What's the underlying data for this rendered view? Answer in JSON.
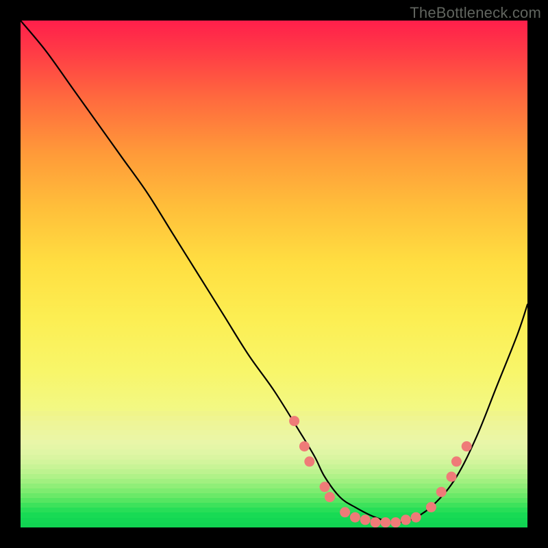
{
  "watermark": "TheBottleneck.com",
  "chart_data": {
    "type": "line",
    "title": "",
    "xlabel": "",
    "ylabel": "",
    "xlim": [
      0,
      100
    ],
    "ylim": [
      0,
      100
    ],
    "series": [
      {
        "name": "bottleneck-curve",
        "x": [
          0,
          5,
          10,
          15,
          20,
          25,
          30,
          35,
          40,
          45,
          50,
          55,
          58,
          60,
          63,
          66,
          70,
          74,
          78,
          82,
          86,
          90,
          94,
          98,
          100
        ],
        "y": [
          100,
          94,
          87,
          80,
          73,
          66,
          58,
          50,
          42,
          34,
          27,
          19,
          14,
          10,
          6,
          4,
          2,
          1,
          2,
          5,
          10,
          18,
          28,
          38,
          44
        ]
      }
    ],
    "markers": [
      {
        "x": 54,
        "y": 21
      },
      {
        "x": 56,
        "y": 16
      },
      {
        "x": 57,
        "y": 13
      },
      {
        "x": 60,
        "y": 8
      },
      {
        "x": 61,
        "y": 6
      },
      {
        "x": 64,
        "y": 3
      },
      {
        "x": 66,
        "y": 2
      },
      {
        "x": 68,
        "y": 1.5
      },
      {
        "x": 70,
        "y": 1
      },
      {
        "x": 72,
        "y": 1
      },
      {
        "x": 74,
        "y": 1
      },
      {
        "x": 76,
        "y": 1.5
      },
      {
        "x": 78,
        "y": 2
      },
      {
        "x": 81,
        "y": 4
      },
      {
        "x": 83,
        "y": 7
      },
      {
        "x": 85,
        "y": 10
      },
      {
        "x": 86,
        "y": 13
      },
      {
        "x": 88,
        "y": 16
      }
    ],
    "gradient_stops": [
      {
        "pct": 0,
        "color": "#ff1f4b"
      },
      {
        "pct": 50,
        "color": "#ffc93a"
      },
      {
        "pct": 77,
        "color": "#f5f77d"
      },
      {
        "pct": 100,
        "color": "#17e86a"
      }
    ],
    "band_colors": [
      "#f0f58a",
      "#eff591",
      "#eef597",
      "#edf59b",
      "#ecf6a0",
      "#ebf6a4",
      "#e9f6a8",
      "#e5f6a7",
      "#e0f6a5",
      "#daf5a1",
      "#d2f59c",
      "#c8f496",
      "#bdf38f",
      "#b0f288",
      "#a1f080",
      "#90ee78",
      "#7eec70",
      "#6be968",
      "#55e661",
      "#3de25b",
      "#27de57",
      "#18da54",
      "#13d753",
      "#11d452"
    ]
  }
}
